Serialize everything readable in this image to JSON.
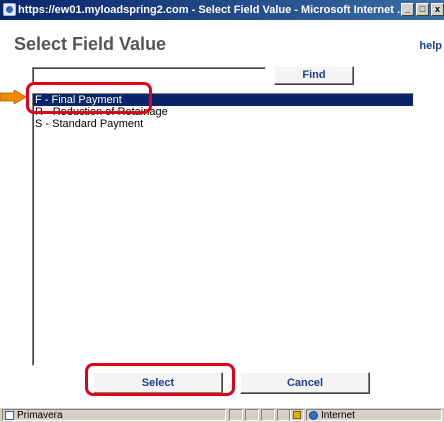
{
  "window": {
    "title": "https://ew01.myloadspring2.com - Select Field Value - Microsoft Internet ...",
    "controls": [
      "minimize",
      "maximize",
      "close"
    ]
  },
  "dialog": {
    "heading": "Select Field Value",
    "help_link": "help",
    "search": {
      "value": "",
      "placeholder": ""
    },
    "find_label": "Find",
    "items": [
      {
        "label": "F - Final Payment",
        "selected": true
      },
      {
        "label": "R - Reduction of Retainage",
        "selected": false
      },
      {
        "label": "S - Standard Payment",
        "selected": false
      }
    ],
    "select_label": "Select",
    "cancel_label": "Cancel"
  },
  "statusbar": {
    "left_text": "Primavera",
    "zone_text": "Internet"
  },
  "colors": {
    "title_bar": "#0a246a",
    "selection": "#0a246a",
    "button_text": "#1d3f8a",
    "callout": "#e0001a"
  },
  "icons": [
    "ie-page-icon",
    "minimize-icon",
    "maximize-icon",
    "close-icon",
    "arrow-pointer-icon",
    "page-icon",
    "lock-icon",
    "globe-icon"
  ]
}
